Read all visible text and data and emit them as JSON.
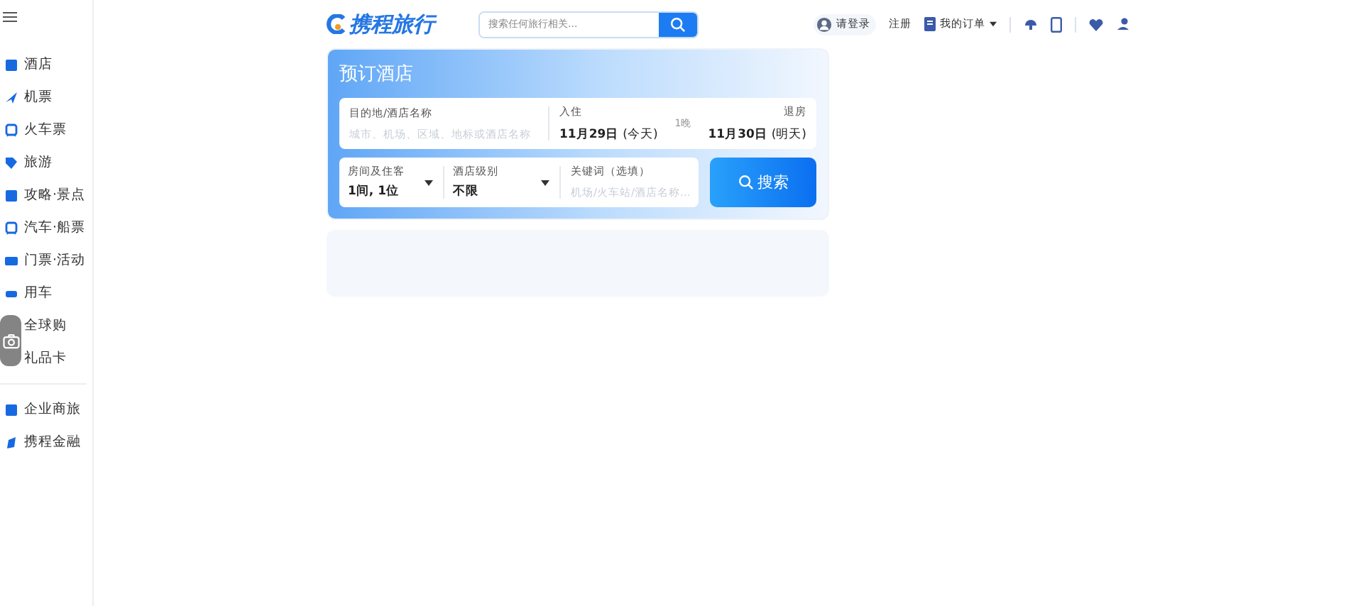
{
  "sidebar": {
    "items": [
      {
        "label": "酒店"
      },
      {
        "label": "机票"
      },
      {
        "label": "火车票"
      },
      {
        "label": "旅游"
      },
      {
        "label": "攻略·景点"
      },
      {
        "label": "汽车·船票"
      },
      {
        "label": "门票·活动"
      },
      {
        "label": "用车"
      },
      {
        "label": "全球购"
      },
      {
        "label": "礼品卡"
      }
    ],
    "extra_items": [
      {
        "label": "企业商旅"
      },
      {
        "label": "携程金融"
      }
    ]
  },
  "header": {
    "logo": "携程旅行",
    "search": {
      "placeholder": "搜索任何旅行相关..."
    },
    "login": "请登录",
    "register": "注册",
    "orders": "我的订单"
  },
  "booking": {
    "title": "预订酒店",
    "destination": {
      "label": "目的地/酒店名称",
      "placeholder": "城市、机场、区域、地标或酒店名称"
    },
    "checkin": {
      "label": "入住",
      "date": "11月29日",
      "day": "(今天)"
    },
    "nights": "1晚",
    "checkout": {
      "label": "退房",
      "date": "11月30日",
      "day": "(明天)"
    },
    "rooms": {
      "label": "房间及住客",
      "value": "1间, 1位"
    },
    "level": {
      "label": "酒店级别",
      "value": "不限"
    },
    "keyword": {
      "label": "关键词（选填）",
      "placeholder": "机场/火车站/酒店名称..."
    },
    "search_button": "搜索"
  }
}
